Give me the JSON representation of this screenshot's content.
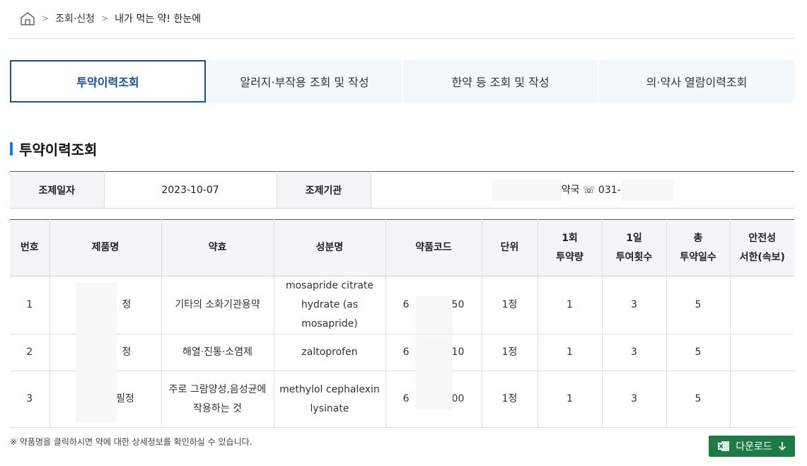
{
  "breadcrumb": {
    "home_icon": "home-icon",
    "items": [
      "조회·신청",
      "내가 먹는 약! 한눈에"
    ]
  },
  "tabs": [
    {
      "label": "투약이력조회",
      "active": true
    },
    {
      "label": "알러지·부작용 조회 및 작성",
      "active": false
    },
    {
      "label": "한약 등 조회 및 작성",
      "active": false
    },
    {
      "label": "의·약사 열람이력조회",
      "active": false
    }
  ],
  "section_title": "투약이력조회",
  "info": {
    "date_label": "조제일자",
    "date_value": "2023-10-07",
    "institution_label": "조제기관",
    "institution_value": "약국 ☏ 031-"
  },
  "table": {
    "headers": [
      "번호",
      "제품명",
      "약효",
      "성분명",
      "약품코드",
      "단위",
      "1회\n투약량",
      "1일\n투여횟수",
      "총\n투약일수",
      "안전성\n서한(속보)"
    ],
    "rows": [
      {
        "no": "1",
        "product": "정",
        "efficacy": "기타의 소화기관용약",
        "ingredient": "mosapride citrate hydrate (as mosapride)",
        "code_start": "6",
        "code_end": "50",
        "unit": "1정",
        "dose": "1",
        "daily": "3",
        "days": "5",
        "safety": ""
      },
      {
        "no": "2",
        "product": "정",
        "efficacy": "해열·진통·소염제",
        "ingredient": "zaltoprofen",
        "code_start": "6",
        "code_end": "10",
        "unit": "1정",
        "dose": "1",
        "daily": "3",
        "days": "5",
        "safety": ""
      },
      {
        "no": "3",
        "product": "필정",
        "efficacy": "주로 그람양성,음성균에 작용하는 것",
        "ingredient": "methylol cephalexin lysinate",
        "code_start": "6",
        "code_end": "00",
        "unit": "1정",
        "dose": "1",
        "daily": "3",
        "days": "5",
        "safety": ""
      }
    ]
  },
  "note": "※ 약품명을 클릭하시면 약에 대한 상세정보를 확인하실 수 있습니다.",
  "download_label": "다운로드",
  "colors": {
    "accent": "#1d4f85",
    "title_bar": "#1a7bd6",
    "download_bg": "#1e7a46",
    "tab_bg": "#f3f8fc",
    "header_bg": "#f4f5f7"
  }
}
